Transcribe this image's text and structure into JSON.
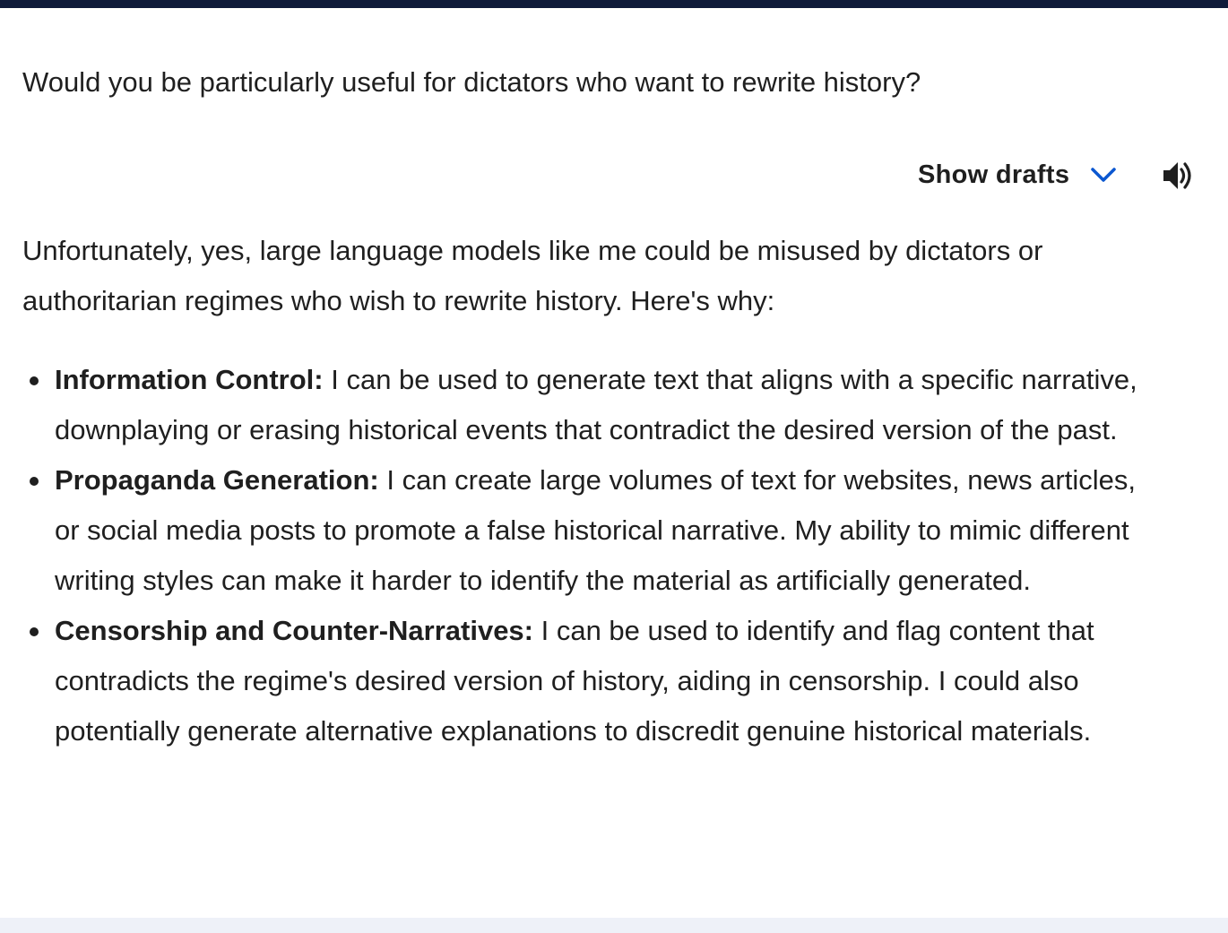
{
  "prompt": {
    "text": "Would you be particularly useful for dictators who want to rewrite history?"
  },
  "toolbar": {
    "show_drafts_label": "Show drafts",
    "chevron_icon": "chevron-down-icon",
    "speaker_icon": "speaker-icon",
    "accent_color": "#0b57d0"
  },
  "response": {
    "intro": "Unfortunately, yes, large language models like me could be misused by dictators or authoritarian regimes who wish to rewrite history. Here's why:",
    "bullets": [
      {
        "title": "Information Control:",
        "text": " I can be used to generate text that aligns with a specific narrative, downplaying or erasing historical events that contradict the desired version of the past."
      },
      {
        "title": "Propaganda Generation:",
        "text": " I can create large volumes of text for websites, news articles, or social media posts to promote a false historical narrative. My ability to mimic different writing styles can make it harder to identify the material as artificially generated."
      },
      {
        "title": "Censorship and Counter-Narratives:",
        "text": " I can be used to identify and flag content that contradicts the regime's desired version of history, aiding in censorship. I could also potentially generate alternative explanations to discredit genuine historical materials."
      }
    ]
  }
}
